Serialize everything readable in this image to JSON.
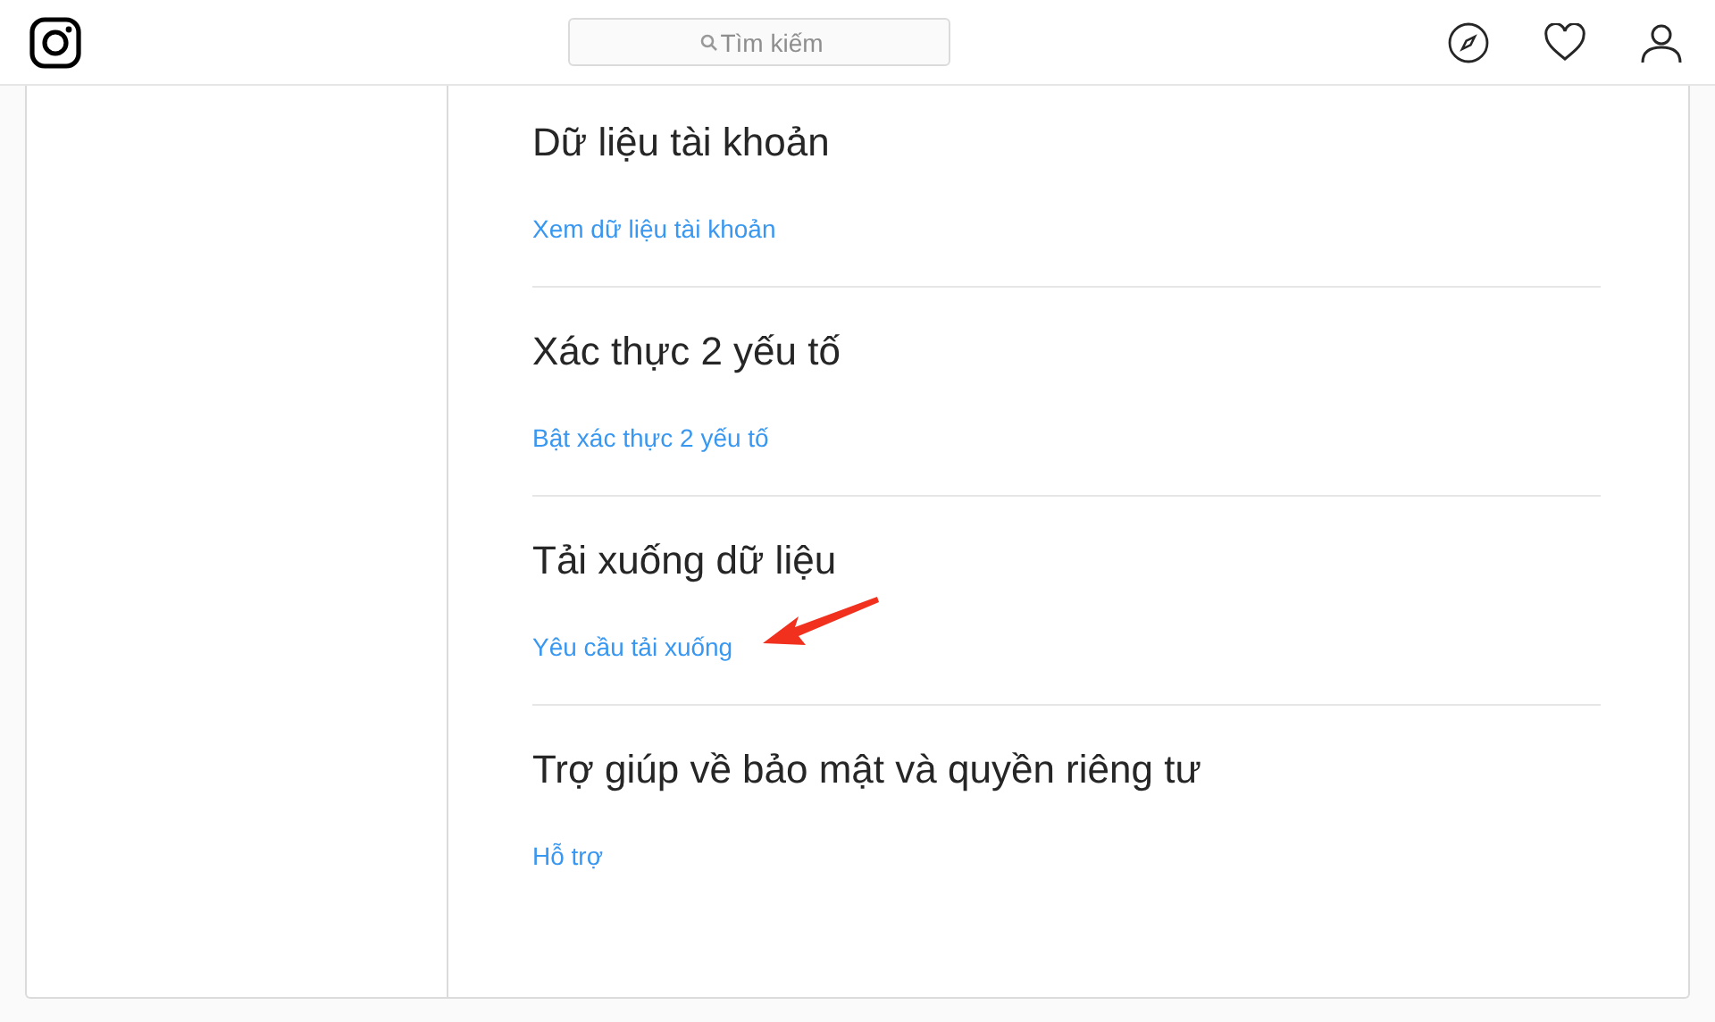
{
  "header": {
    "search": {
      "placeholder": "Tìm kiếm"
    }
  },
  "sections": [
    {
      "title": "Dữ liệu tài khoản",
      "link": "Xem dữ liệu tài khoản"
    },
    {
      "title": "Xác thực 2 yếu tố",
      "link": "Bật xác thực 2 yếu tố"
    },
    {
      "title": "Tải xuống dữ liệu",
      "link": "Yêu cầu tải xuống",
      "annotated": true
    },
    {
      "title": "Trợ giúp về bảo mật và quyền riêng tư",
      "link": "Hỗ trợ"
    }
  ]
}
